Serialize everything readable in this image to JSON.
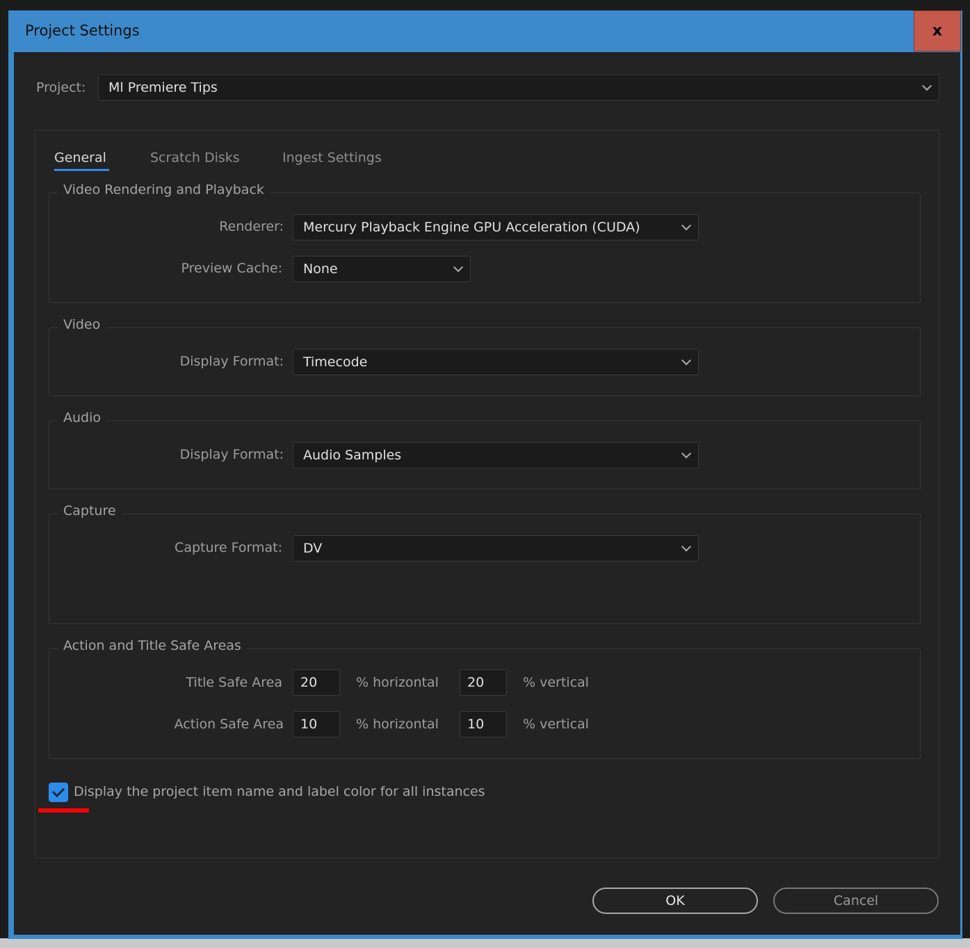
{
  "dialog": {
    "title": "Project Settings",
    "close_label": "x"
  },
  "project": {
    "label": "Project:",
    "value": "Ml Premiere Tips"
  },
  "tabs": [
    {
      "label": "General",
      "active": true
    },
    {
      "label": "Scratch Disks"
    },
    {
      "label": "Ingest Settings"
    }
  ],
  "video_rendering": {
    "legend": "Video Rendering and Playback",
    "renderer_label": "Renderer:",
    "renderer_value": "Mercury Playback Engine GPU Acceleration (CUDA)",
    "cache_label": "Preview Cache:",
    "cache_value": "None"
  },
  "video": {
    "legend": "Video",
    "format_label": "Display Format:",
    "format_value": "Timecode"
  },
  "audio": {
    "legend": "Audio",
    "format_label": "Display Format:",
    "format_value": "Audio Samples"
  },
  "capture": {
    "legend": "Capture",
    "format_label": "Capture Format:",
    "format_value": "DV"
  },
  "safe_areas": {
    "legend": "Action and Title Safe Areas",
    "title_label": "Title Safe Area",
    "title_h": "20",
    "title_v": "20",
    "action_label": "Action Safe Area",
    "action_h": "10",
    "action_v": "10",
    "horizontal": "% horizontal",
    "vertical": "% vertical"
  },
  "checkbox": {
    "label": "Display the project item name and label color for all instances",
    "checked": true
  },
  "buttons": {
    "ok": "OK",
    "cancel": "Cancel"
  },
  "colors": {
    "accent": "#2d8ceb",
    "titlebar": "#3c8acb",
    "close": "#c4594c",
    "annotation": "#ff0000"
  }
}
